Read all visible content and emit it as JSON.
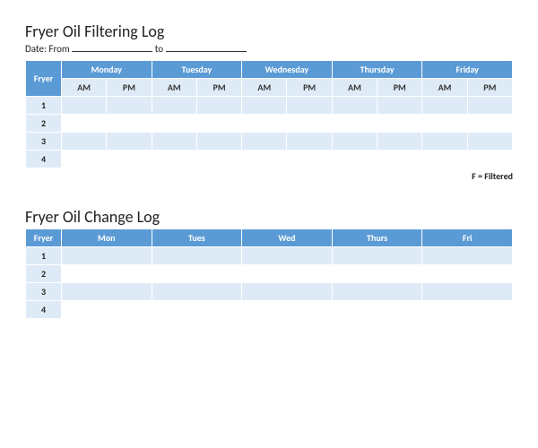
{
  "filtering": {
    "title": "Fryer Oil Filtering Log",
    "date_prefix": "Date: From",
    "date_mid": "to",
    "header_fryer": "Fryer",
    "days": [
      "Monday",
      "Tuesday",
      "Wednesday",
      "Thursday",
      "Friday"
    ],
    "am": "AM",
    "pm": "PM",
    "rows": [
      "1",
      "2",
      "3",
      "4"
    ],
    "legend": "F = Filtered"
  },
  "change": {
    "title": "Fryer Oil Change Log",
    "header_fryer": "Fryer",
    "days": [
      "Mon",
      "Tues",
      "Wed",
      "Thurs",
      "Fri"
    ],
    "rows": [
      "1",
      "2",
      "3",
      "4"
    ]
  }
}
